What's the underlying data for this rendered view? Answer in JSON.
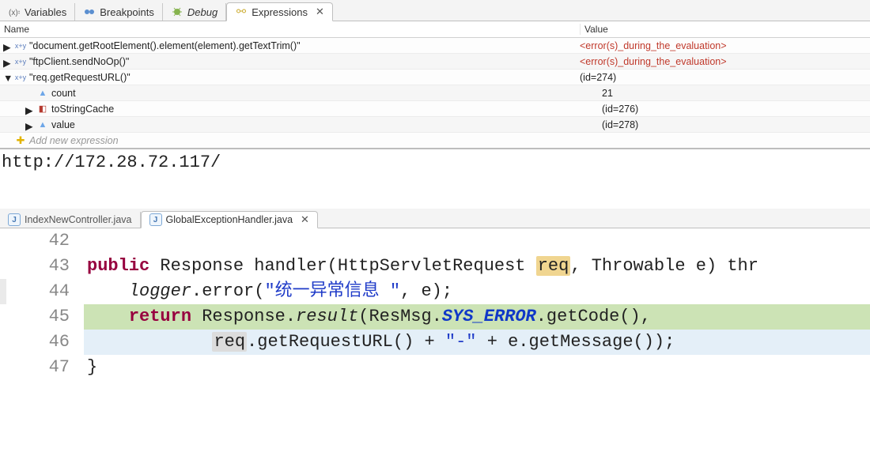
{
  "topTabs": {
    "variables": "Variables",
    "breakpoints": "Breakpoints",
    "debug": "Debug",
    "expressions": "Expressions"
  },
  "columns": {
    "name": "Name",
    "value": "Value"
  },
  "expressions": {
    "rows": [
      {
        "name": "\"document.getRootElement().element(element).getTextTrim()\"",
        "value": "<error(s)_during_the_evaluation>",
        "err": true,
        "icon": "xy",
        "twisty": "right",
        "indent": 0
      },
      {
        "name": "\"ftpClient.sendNoOp()\"",
        "value": "<error(s)_during_the_evaluation>",
        "err": true,
        "icon": "xy",
        "twisty": "right",
        "indent": 0
      },
      {
        "name": "\"req.getRequestURL()\"",
        "value": "(id=274)",
        "err": false,
        "icon": "xy",
        "twisty": "down",
        "indent": 0
      },
      {
        "name": "count",
        "value": "21",
        "err": false,
        "icon": "tri",
        "twisty": "",
        "indent": 1
      },
      {
        "name": "toStringCache",
        "value": "(id=276)",
        "err": false,
        "icon": "box",
        "twisty": "right",
        "indent": 1
      },
      {
        "name": "value",
        "value": "(id=278)",
        "err": false,
        "icon": "tri",
        "twisty": "right",
        "indent": 1
      }
    ],
    "add_new": "Add new expression"
  },
  "detail": "http://172.28.72.117/",
  "editorTabs": {
    "a": "IndexNewController.java",
    "b": "GlobalExceptionHandler.java"
  },
  "code": {
    "lines": [
      "42",
      "43",
      "44",
      "45",
      "46",
      "47"
    ],
    "l42a": "public",
    "l42b": " Response handler(HttpServletRequest ",
    "l42c": "req",
    "l42d": ", Throwable e) thr",
    "l43a": "logger",
    "l43b": ".error(",
    "l43c": "\"统一异常信息 \"",
    "l43d": ", e);",
    "l44a": "return",
    "l44b": " Response.",
    "l44c": "result",
    "l44d": "(ResMsg.",
    "l44e": "SYS_ERROR",
    "l44f": ".getCode(),",
    "l45a": "req",
    "l45b": ".getRequestURL() + ",
    "l45c": "\"-\"",
    "l45d": " + e.getMessage());",
    "l46": "}"
  }
}
